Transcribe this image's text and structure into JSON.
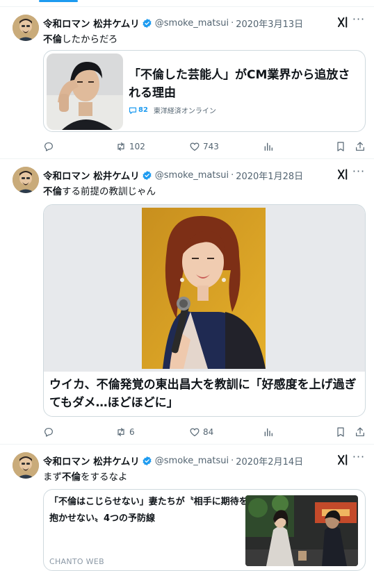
{
  "colors": {
    "accent": "#1d9bf0",
    "text": "#0f1419",
    "muted": "#536471",
    "border": "#cfd9de"
  },
  "icons": {
    "verified": "verified-badge-icon",
    "grok": "grok-icon",
    "more": "more-icon",
    "reply": "reply-icon",
    "retweet": "retweet-icon",
    "like": "like-icon",
    "views": "views-icon",
    "bookmark": "bookmark-icon",
    "share": "share-icon"
  },
  "more_glyph": "···",
  "tweets": [
    {
      "name": "令和ロマン 松井ケムリ",
      "handle": "@smoke_matsui",
      "dot": "·",
      "date": "2020年3月13日",
      "text_bold": "不倫",
      "text_rest": "したからだろ",
      "card": {
        "title": "「不倫した芸能人」がCM業界から追放される理由",
        "comments": "82",
        "source": "東洋経済オンライン"
      },
      "stats": {
        "retweets": "102",
        "likes": "743"
      }
    },
    {
      "name": "令和ロマン 松井ケムリ",
      "handle": "@smoke_matsui",
      "dot": "·",
      "date": "2020年1月28日",
      "text_bold": "不倫",
      "text_rest": "する前提の教訓じゃん",
      "card": {
        "caption": "ウイカ、不倫発覚の東出昌大を教訓に「好感度を上げ過ぎてもダメ…ほどほどに」"
      },
      "stats": {
        "retweets": "6",
        "likes": "84"
      }
    },
    {
      "name": "令和ロマン 松井ケムリ",
      "handle": "@smoke_matsui",
      "dot": "·",
      "date": "2020年2月14日",
      "text_pre": "まず",
      "text_bold": "不倫",
      "text_rest": "をするなよ",
      "card": {
        "title": "「不倫はこじらせない」妻たちが〝相手に期待を抱かせない〟4つの予防線",
        "source": "CHANTO WEB"
      }
    }
  ]
}
